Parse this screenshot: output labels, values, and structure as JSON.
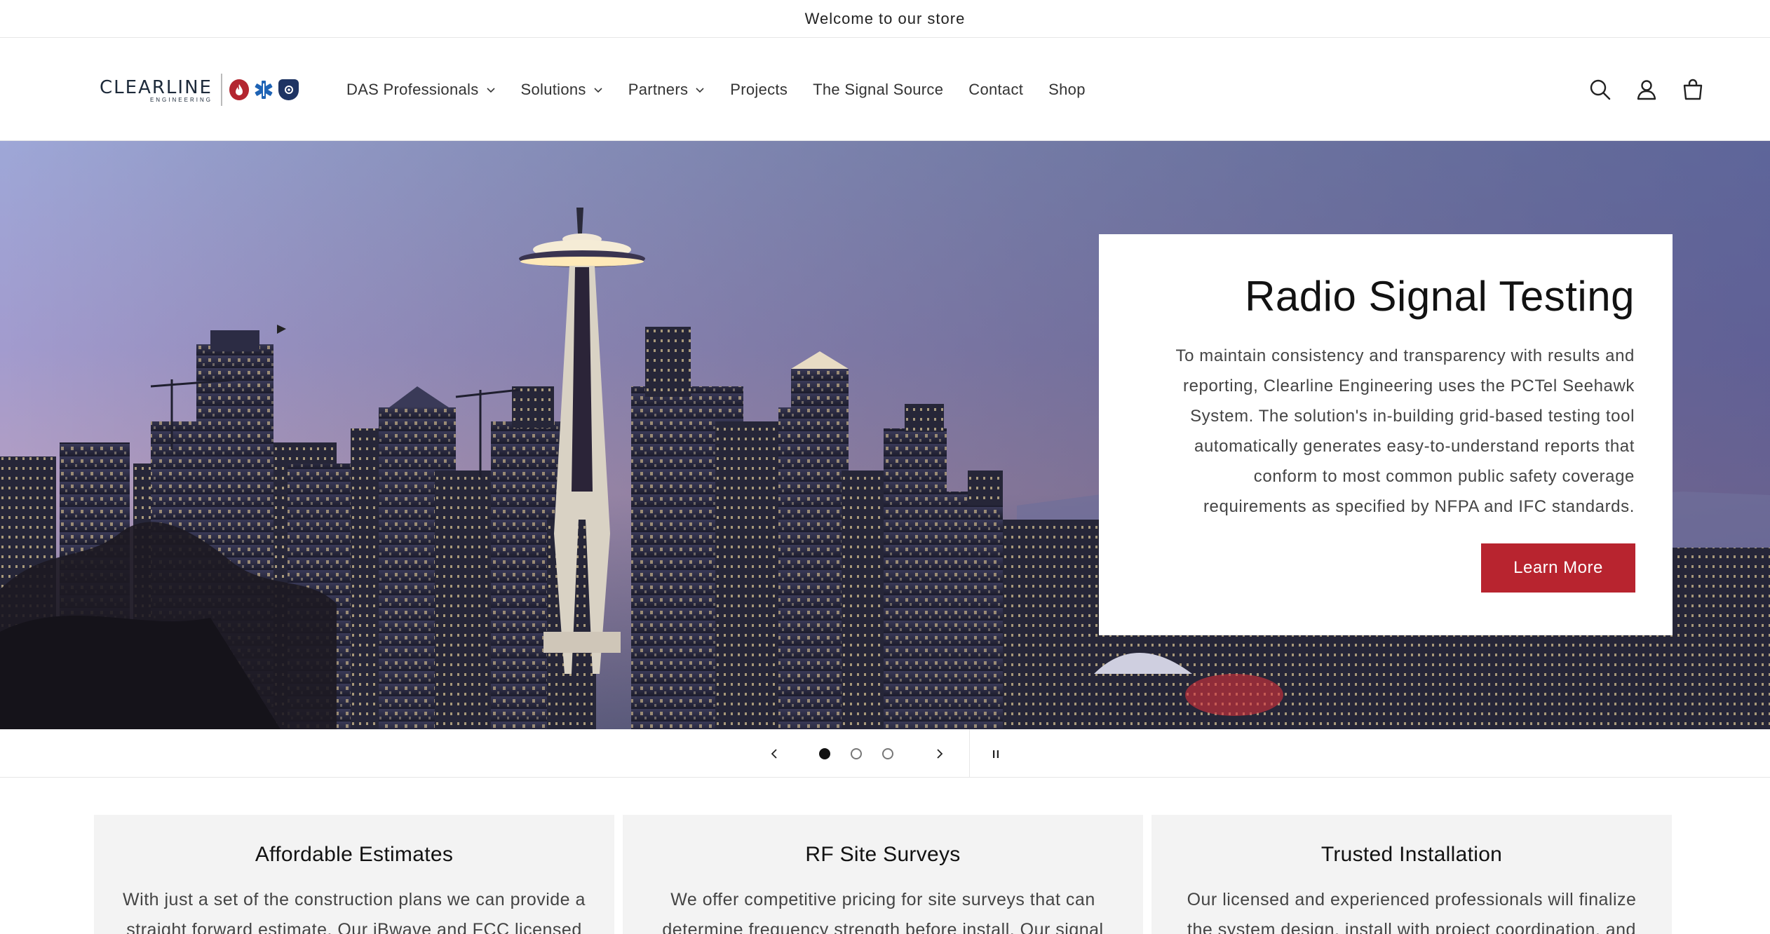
{
  "announcement": {
    "text": "Welcome to our store"
  },
  "logo": {
    "name": "CLEARLINE",
    "sub": "ENGINEERING"
  },
  "nav": {
    "items": [
      {
        "label": "DAS Professionals",
        "dropdown": true
      },
      {
        "label": "Solutions",
        "dropdown": true
      },
      {
        "label": "Partners",
        "dropdown": true
      },
      {
        "label": "Projects",
        "dropdown": false
      },
      {
        "label": "The Signal Source",
        "dropdown": false
      },
      {
        "label": "Contact",
        "dropdown": false
      },
      {
        "label": "Shop",
        "dropdown": false
      }
    ]
  },
  "header_icons": [
    "search-icon",
    "account-icon",
    "cart-icon"
  ],
  "hero": {
    "title": "Radio Signal Testing",
    "lines": [
      "To maintain consistency and transparency with results and",
      "reporting, Clearline Engineering uses the PCTel Seehawk",
      "System. The solution's in-building grid-based testing tool",
      "automatically generates easy-to-understand reports that",
      "conform to most common public safety coverage",
      "requirements as specified by NFPA and IFC standards."
    ],
    "button": "Learn More"
  },
  "slider": {
    "slides": 3,
    "active": 1
  },
  "features": [
    {
      "title": "Affordable Estimates",
      "text": "With just a set of the construction plans we can provide a straight forward estimate. Our iBwave and FCC licensed"
    },
    {
      "title": "RF Site Surveys",
      "text": "We offer competitive pricing for site surveys that can determine frequency strength before install. Our signal"
    },
    {
      "title": "Trusted Installation",
      "text": "Our licensed and experienced professionals will finalize the system design, install with project coordination, and"
    }
  ],
  "colors": {
    "accent": "#b8242f",
    "brand_navy": "#1d2a3a"
  }
}
